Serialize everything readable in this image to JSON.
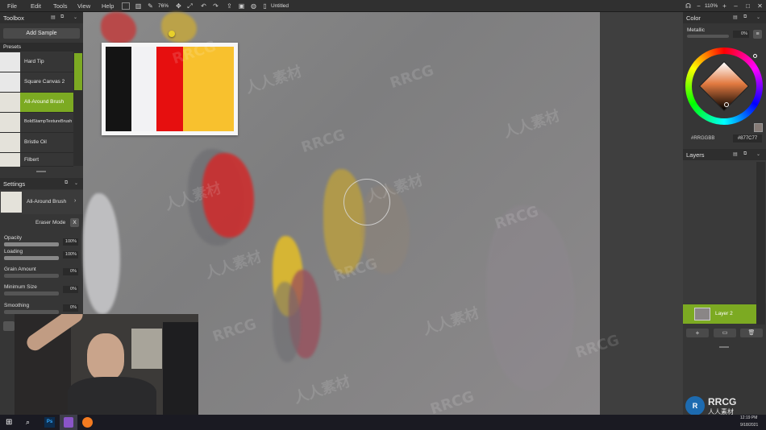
{
  "menubar": {
    "items": [
      "File",
      "Edit",
      "Tools",
      "View",
      "Help"
    ],
    "zoom": "76%",
    "doc_title": "Untitled",
    "window_zoom": "110%"
  },
  "toolbox": {
    "title": "Toolbox",
    "add_sample": "Add Sample",
    "presets_title": "Presets",
    "presets": [
      "Hard Tip",
      "Square Canvas 2",
      "All-Around Brush",
      "BoldStampTextureBrush",
      "Bristle Oil",
      "Filbert"
    ],
    "selected_preset": "All-Around Brush"
  },
  "settings": {
    "title": "Settings",
    "current_brush": "All-Around Brush",
    "eraser_mode": "Eraser Mode",
    "eraser_key": "X",
    "sliders": [
      {
        "label": "Opacity",
        "value": "100%",
        "fraction": 1.0
      },
      {
        "label": "Loading",
        "value": "100%",
        "fraction": 1.0
      },
      {
        "label": "Grain Amount",
        "value": "0%",
        "fraction": 0.0
      },
      {
        "label": "Minimum Size",
        "value": "0%",
        "fraction": 0.0
      },
      {
        "label": "Smoothing",
        "value": "0%",
        "fraction": 0.0
      }
    ]
  },
  "color": {
    "title": "Color",
    "metallic_label": "Metallic",
    "metallic_value": "0%",
    "hex_left": "#RRGGBB",
    "hex_right": "#877C77",
    "current_color": "#877C77"
  },
  "layers": {
    "title": "Layers",
    "items": [
      {
        "name": "Layer 2",
        "selected": true
      }
    ]
  },
  "swatch_card": {
    "colors": [
      "#141414",
      "#f2f2f4",
      "#e60f0f",
      "#f8c12e"
    ]
  },
  "watermark": {
    "latin": "RRCG",
    "cjk": "人人素材"
  },
  "taskbar": {
    "time": "12:19 PM",
    "date": "9/18/2021"
  },
  "logo": {
    "mark": "RRCG",
    "sub": "人人素材"
  }
}
